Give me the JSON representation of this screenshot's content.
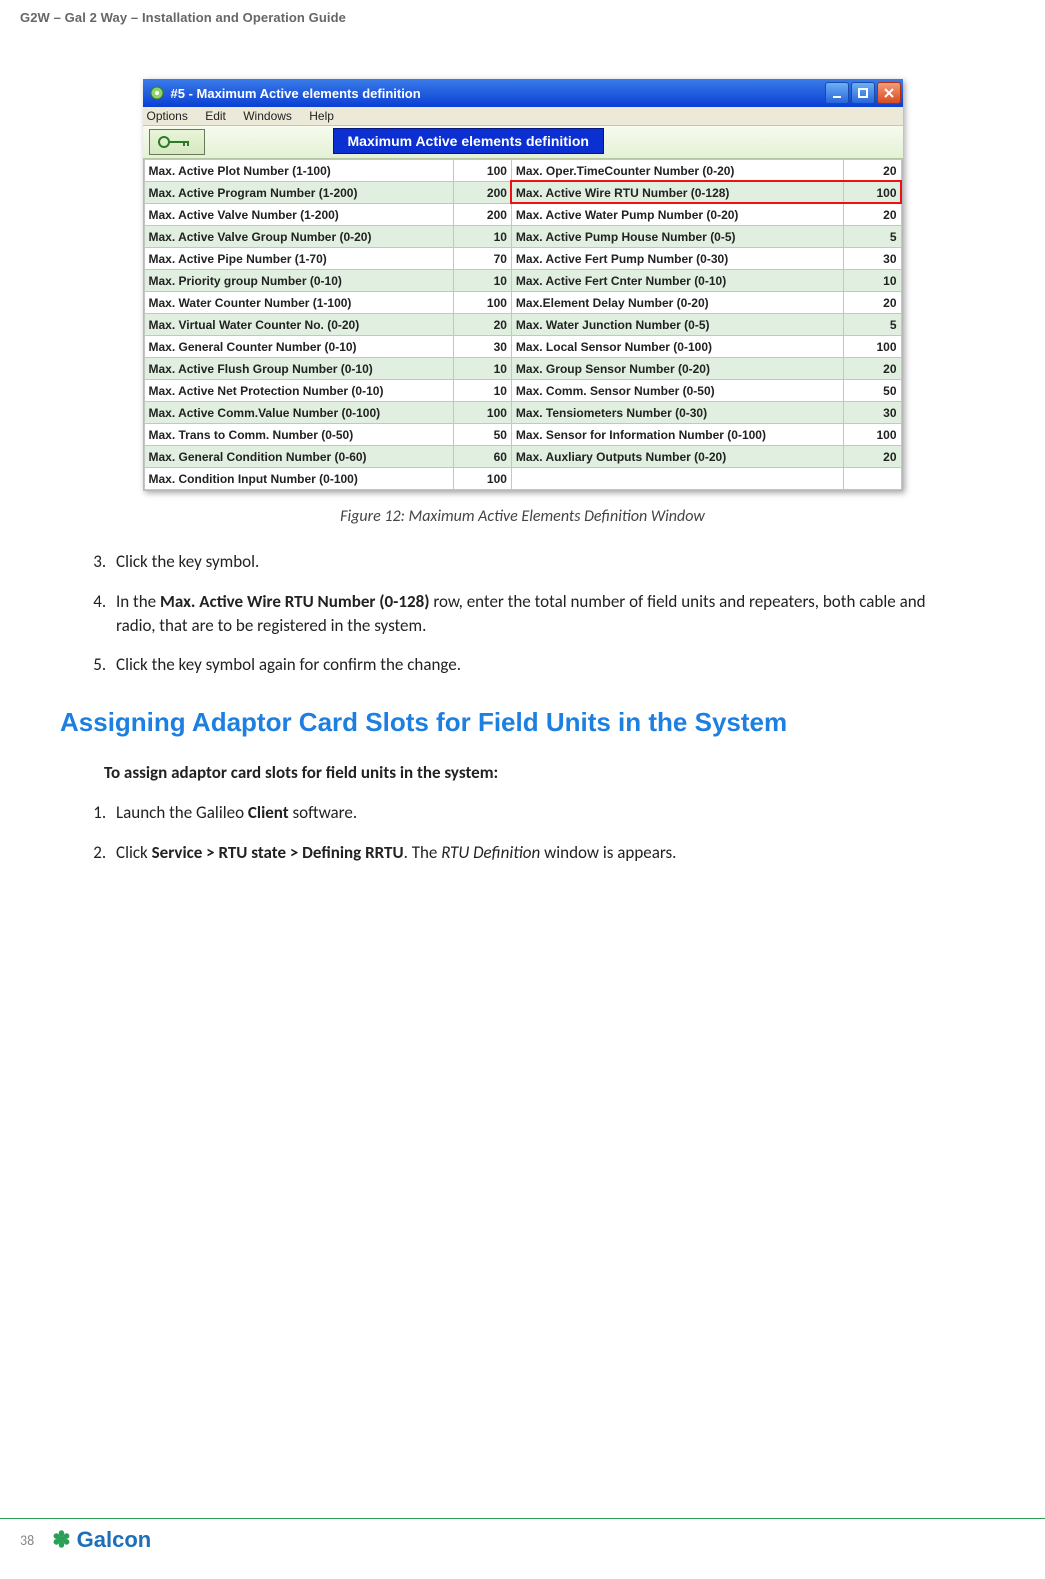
{
  "doc_header": "G2W – Gal 2 Way – Installation and Operation Guide",
  "window": {
    "title": "#5  - Maximum Active elements definition",
    "menu": {
      "options": "Options",
      "edit": "Edit",
      "windows": "Windows",
      "help": "Help"
    },
    "banner": "Maximum Active elements definition"
  },
  "table": {
    "left": [
      {
        "label": "Max. Active Plot Number (1-100)",
        "value": "100"
      },
      {
        "label": "Max. Active Program Number (1-200)",
        "value": "200"
      },
      {
        "label": "Max. Active Valve Number (1-200)",
        "value": "200"
      },
      {
        "label": "Max. Active Valve Group Number (0-20)",
        "value": "10"
      },
      {
        "label": "Max. Active Pipe Number (1-70)",
        "value": "70"
      },
      {
        "label": "Max. Priority group Number (0-10)",
        "value": "10"
      },
      {
        "label": "Max. Water Counter Number (1-100)",
        "value": "100"
      },
      {
        "label": "Max. Virtual Water Counter No. (0-20)",
        "value": "20"
      },
      {
        "label": "Max. General Counter Number (0-10)",
        "value": "30"
      },
      {
        "label": "Max. Active Flush Group Number (0-10)",
        "value": "10"
      },
      {
        "label": "Max. Active Net Protection Number (0-10)",
        "value": "10"
      },
      {
        "label": "Max. Active Comm.Value Number (0-100)",
        "value": "100"
      },
      {
        "label": "Max. Trans to Comm. Number (0-50)",
        "value": "50"
      },
      {
        "label": "Max. General Condition Number (0-60)",
        "value": "60"
      },
      {
        "label": "Max. Condition Input Number (0-100)",
        "value": "100"
      }
    ],
    "right": [
      {
        "label": "Max. Oper.TimeCounter Number (0-20)",
        "value": "20"
      },
      {
        "label": "Max. Active Wire RTU Number (0-128)",
        "value": "100",
        "highlight": true
      },
      {
        "label": "Max. Active Water Pump Number (0-20)",
        "value": "20"
      },
      {
        "label": "Max. Active Pump House Number (0-5)",
        "value": "5"
      },
      {
        "label": "Max. Active Fert Pump Number (0-30)",
        "value": "30"
      },
      {
        "label": "Max. Active Fert Cnter Number (0-10)",
        "value": "10"
      },
      {
        "label": "Max.Element Delay Number (0-20)",
        "value": "20"
      },
      {
        "label": "Max. Water Junction Number (0-5)",
        "value": "5"
      },
      {
        "label": "Max. Local Sensor Number (0-100)",
        "value": "100"
      },
      {
        "label": "Max. Group Sensor Number (0-20)",
        "value": "20"
      },
      {
        "label": "Max. Comm. Sensor Number (0-50)",
        "value": "50"
      },
      {
        "label": "Max. Tensiometers Number (0-30)",
        "value": "30"
      },
      {
        "label": "Max. Sensor for Information Number (0-100)",
        "value": "100"
      },
      {
        "label": "Max. Auxliary Outputs Number (0-20)",
        "value": "20"
      },
      {
        "label": "",
        "value": ""
      }
    ]
  },
  "figure_caption": "Figure 12:  Maximum Active Elements Definition Window",
  "steps_a": {
    "start": "3",
    "s3": "Click the key symbol.",
    "s4_pre": "In the ",
    "s4_bold": "Max. Active Wire RTU Number (0-128)",
    "s4_post": " row, enter the total number of field units and repeaters, both cable and radio, that are to be registered in the system.",
    "s5": "Click the key symbol again for confirm the change."
  },
  "section_heading": "Assigning Adaptor Card Slots for Field Units in the System",
  "sub_intro": "To assign adaptor card slots for field units in the system:",
  "steps_b": {
    "s1_pre": "Launch the Galileo ",
    "s1_bold": "Client",
    "s1_post": " software.",
    "s2_pre": "Click ",
    "s2_bold": "Service > RTU state > Defining RRTU",
    "s2_post1": ". The ",
    "s2_italic": "RTU Definition",
    "s2_post2": " window is appears."
  },
  "footer": {
    "page": "38",
    "brand": "Galcon"
  }
}
